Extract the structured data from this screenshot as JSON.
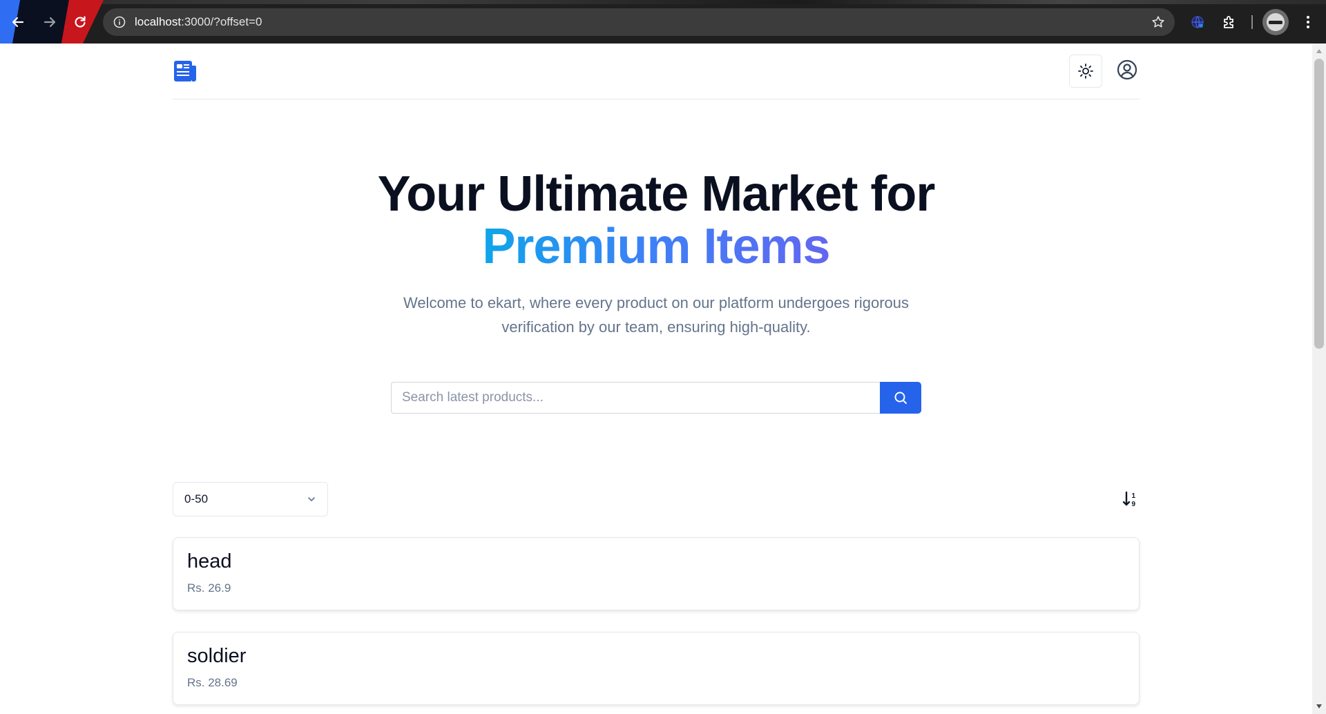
{
  "browser": {
    "url_host": "localhost",
    "url_path": ":3000/?offset=0"
  },
  "hero": {
    "title_line1": "Your Ultimate Market for",
    "title_line2": "Premium Items",
    "subtitle": "Welcome to ekart, where every product on our platform undergoes rigorous verification by our team, ensuring high-quality."
  },
  "search": {
    "placeholder": "Search latest products..."
  },
  "filter": {
    "range_selected": "0-50"
  },
  "products": [
    {
      "name": "head",
      "price": "Rs. 26.9"
    },
    {
      "name": "soldier",
      "price": "Rs. 28.69"
    }
  ],
  "colors": {
    "primary": "#2563eb",
    "title": "#0b1020",
    "muted": "#64748b",
    "gradient_start": "#0ea5e9",
    "gradient_end": "#6366f1"
  },
  "icons": {
    "back": "arrow-left-icon",
    "forward": "arrow-right-icon",
    "reload": "reload-icon",
    "site_info": "info-icon",
    "bookmark": "star-icon",
    "logo": "newspaper-icon",
    "theme": "sun-icon",
    "user": "user-circle-icon",
    "search": "search-icon",
    "sort": "sort-descending-icon"
  }
}
